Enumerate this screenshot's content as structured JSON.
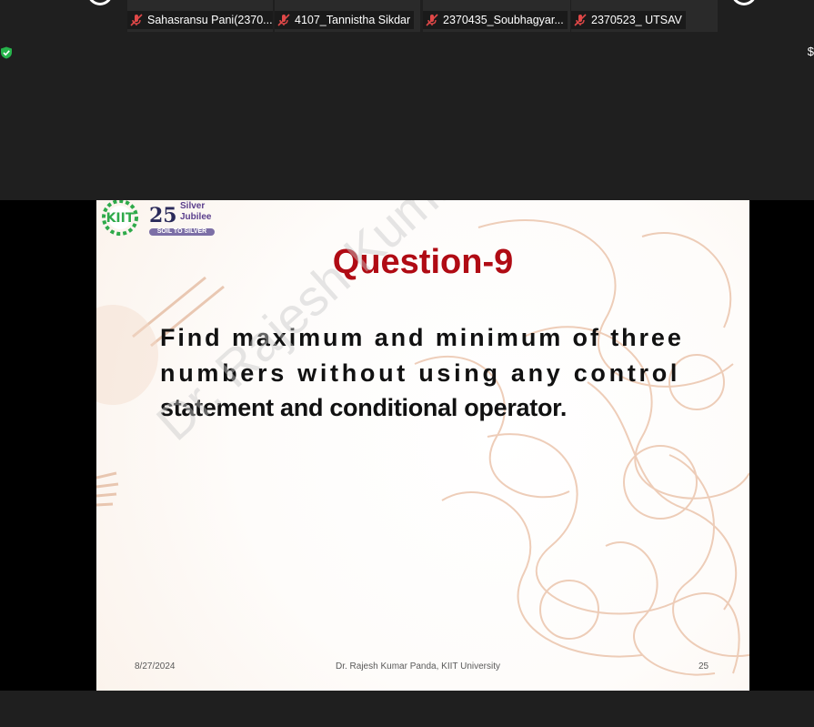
{
  "participants": [
    {
      "name": "Sahasransu Pani(2370...",
      "muted": true
    },
    {
      "name": "4107_Tannistha Sikdar",
      "muted": true
    },
    {
      "name": "2370435_Soubhagyar...",
      "muted": true
    },
    {
      "name": "2370523_ UTSAV",
      "muted": true
    }
  ],
  "slide": {
    "logo": {
      "kiit_text": "KIIT",
      "anniversary_number": "25",
      "silver": "Silver",
      "jubilee": "Jubilee",
      "tagline": "SOIL TO SILVER"
    },
    "title": "Question-9",
    "body_lines": [
      "Find maximum and minimum of three",
      "numbers without using any control",
      "statement and conditional operator."
    ],
    "watermark": "Dr. Rajesh Kumar Panda",
    "footer": {
      "date": "8/27/2024",
      "author": "Dr. Rajesh Kumar Panda, KIIT University",
      "page": "25"
    }
  },
  "colors": {
    "title": "#b00b14",
    "meeting_bg": "#1f1f1f",
    "tile_bg": "#2a2a2a",
    "mic_muted": "#e04848",
    "shield": "#26b34b"
  },
  "icons": {
    "mic": "mic-off-icon",
    "shield": "shield-check-icon",
    "avatar": "avatar-icon"
  }
}
